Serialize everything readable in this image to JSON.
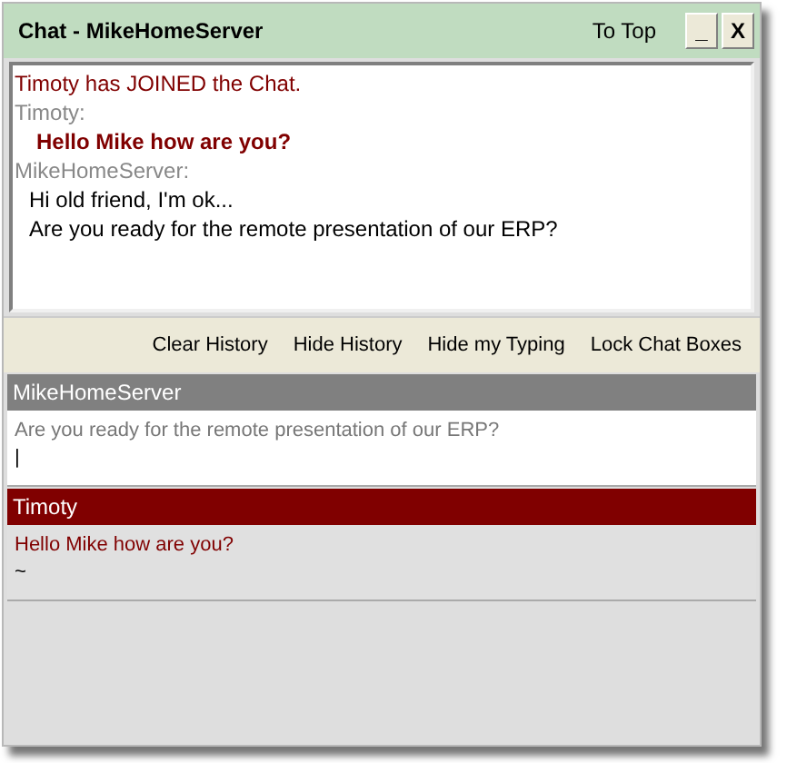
{
  "window": {
    "title": "Chat - MikeHomeServer",
    "to_top": "To Top",
    "minimize": "_",
    "close": "X"
  },
  "history": [
    {
      "kind": "system",
      "text": "Timoty has JOINED the Chat."
    },
    {
      "kind": "sender",
      "text": "Timoty:"
    },
    {
      "kind": "remote",
      "text": "Hello Mike how are you?"
    },
    {
      "kind": "sender",
      "text": "MikeHomeServer:"
    },
    {
      "kind": "local",
      "text": "Hi old friend, I'm ok..."
    },
    {
      "kind": "local",
      "text": "Are you ready for the remote presentation of our ERP?"
    }
  ],
  "toolbar": [
    "Clear History",
    "Hide History",
    "Hide my Typing",
    "Lock Chat Boxes"
  ],
  "panels": [
    {
      "name": "MikeHomeServer",
      "color": "#808080",
      "kind": "editable",
      "text": "Are you ready for the remote presentation of our ERP?",
      "cursor": "|"
    },
    {
      "name": "Timoty",
      "color": "#800000",
      "kind": "readonly",
      "text": "Hello Mike how are you?",
      "cursor": "~"
    }
  ]
}
